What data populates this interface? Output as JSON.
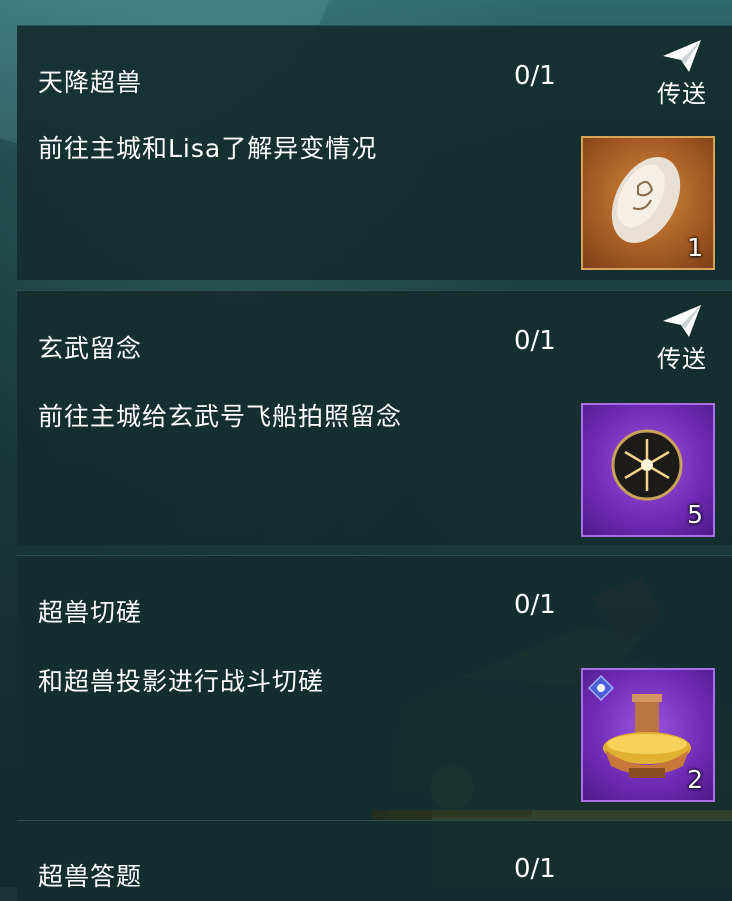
{
  "quests": [
    {
      "title": "天降超兽",
      "progress": "0/1",
      "description": "前往主城和Lisa了解异变情况",
      "teleport_label": "传送",
      "reward": {
        "item_icon": "carved-stone-icon",
        "count": "1",
        "frame_color": "#d7a35b"
      }
    },
    {
      "title": "玄武留念",
      "progress": "0/1",
      "description": "前往主城给玄武号飞船拍照留念",
      "teleport_label": "传送",
      "reward": {
        "item_icon": "dark-orb-icon",
        "count": "5",
        "frame_color": "#a86fe6"
      }
    },
    {
      "title": "超兽切磋",
      "progress": "0/1",
      "description": "和超兽投影进行战斗切磋",
      "reward": {
        "item_icon": "hotpot-icon",
        "count": "2",
        "frame_color": "#a86fe6"
      }
    },
    {
      "title": "超兽答题",
      "progress": "0/1"
    }
  ]
}
